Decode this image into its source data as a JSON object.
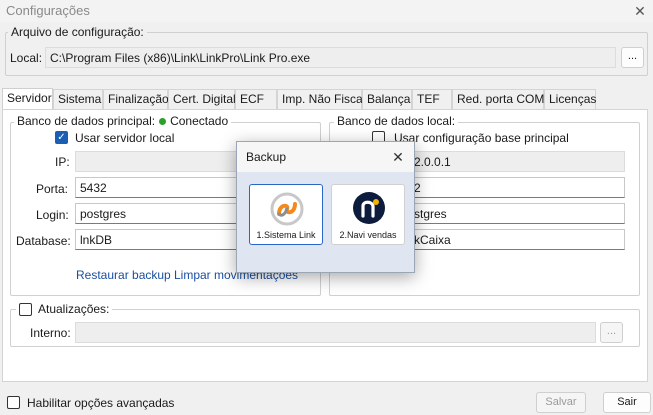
{
  "window": {
    "title": "Configurações",
    "close_glyph": "✕"
  },
  "config_file": {
    "legend": "Arquivo de configuração:",
    "local_label": "Local:",
    "local_value": "C:\\Program Files (x86)\\Link\\LinkPro\\Link Pro.exe",
    "browse_label": "..."
  },
  "tabs": [
    {
      "label": "Servidor",
      "active": true
    },
    {
      "label": "Sistema"
    },
    {
      "label": "Finalização"
    },
    {
      "label": "Cert. Digital"
    },
    {
      "label": "ECF"
    },
    {
      "label": "Imp. Não Fiscal"
    },
    {
      "label": "Balança"
    },
    {
      "label": "TEF"
    },
    {
      "label": "Red. porta COM"
    },
    {
      "label": "Licenças"
    }
  ],
  "principal_db": {
    "legend": "Banco de dados principal:",
    "status": "Conectado",
    "status_color": "#2aa12a",
    "use_local_label": "Usar servidor local",
    "use_local_checked": true,
    "ip_label": "IP:",
    "ip_value": "",
    "porta_label": "Porta:",
    "porta_value": "5432",
    "login_label": "Login:",
    "login_value": "postgres",
    "database_label": "Database:",
    "database_value": "lnkDB",
    "restore_link": "Restaurar backup",
    "clear_link": "Limpar movimentações"
  },
  "local_db": {
    "legend": "Banco de dados local:",
    "use_base_label": "Usar configuração base principal",
    "use_base_checked": false,
    "ip_value_visible": "2.0.0.1",
    "porta_value_visible": "2",
    "login_value_visible": "stgres",
    "database_value_visible": "kCaixa"
  },
  "updates": {
    "label": "Atualizações:",
    "checked": false,
    "interno_label": "Interno:",
    "interno_value": "",
    "browse_label": "..."
  },
  "footer": {
    "advanced_label": "Habilitar opções avançadas",
    "advanced_checked": false,
    "save_label": "Salvar",
    "exit_label": "Sair"
  },
  "backup_dialog": {
    "title": "Backup",
    "close_glyph": "✕",
    "options": [
      {
        "label": "1.Sistema Link",
        "icon": "sistema-link-logo",
        "selected": true
      },
      {
        "label": "2.Navi vendas",
        "icon": "navi-logo",
        "selected": false
      }
    ],
    "navi_logo_color": "#0d1b3d",
    "navi_dot_color": "#f0b400",
    "link_logo_colors": [
      "#f28a1e",
      "#8e8e8e"
    ]
  }
}
